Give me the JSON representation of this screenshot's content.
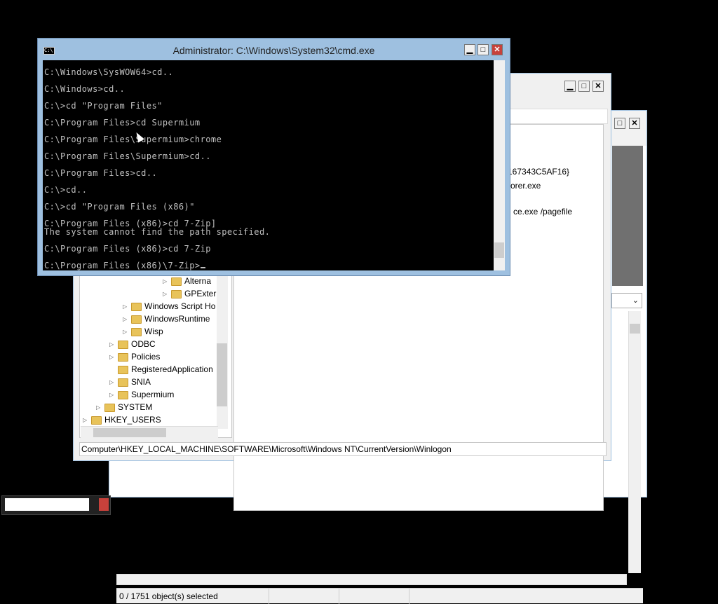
{
  "cmd_window": {
    "title": "Administrator: C:\\Windows\\System32\\cmd.exe",
    "icon": "cmd-icon",
    "buttons": {
      "minimize": "▁",
      "maximize": "□",
      "close": "✕"
    },
    "lines": [
      "C:\\Windows\\SysWOW64>cd..",
      "",
      "C:\\Windows>cd..",
      "",
      "C:\\>cd \"Program Files\"",
      "",
      "C:\\Program Files>cd Supermium",
      "",
      "C:\\Program Files\\Supermium>chrome",
      "",
      "C:\\Program Files\\Supermium>cd..",
      "",
      "C:\\Program Files>cd..",
      "",
      "C:\\>cd..",
      "",
      "C:\\>cd \"Program Files (x86)\"",
      "",
      "C:\\Program Files (x86)>cd 7-Zip]",
      "The system cannot find the path specified.",
      "",
      "C:\\Program Files (x86)>cd 7-Zip",
      "",
      "C:\\Program Files (x86)\\7-Zip>"
    ]
  },
  "registry_window": {
    "buttons": {
      "minimize": "▁",
      "maximize": "□",
      "close": "✕"
    },
    "tree": [
      {
        "label": "Alterna",
        "level": 3,
        "expandable": true
      },
      {
        "label": "GPExter",
        "level": 3,
        "expandable": true
      },
      {
        "label": "Windows Script Ho",
        "level": 2,
        "expandable": true
      },
      {
        "label": "WindowsRuntime",
        "level": 2,
        "expandable": true
      },
      {
        "label": "Wisp",
        "level": 2,
        "expandable": true
      },
      {
        "label": "ODBC",
        "level": 1,
        "expandable": true
      },
      {
        "label": "Policies",
        "level": 1,
        "expandable": true
      },
      {
        "label": "RegisteredApplication",
        "level": 1,
        "expandable": false
      },
      {
        "label": "SNIA",
        "level": 1,
        "expandable": true
      },
      {
        "label": "Supermium",
        "level": 1,
        "expandable": true
      },
      {
        "label": "SYSTEM",
        "level": 0,
        "expandable": true
      },
      {
        "label": "HKEY_USERS",
        "level": -1,
        "expandable": true
      }
    ],
    "values": [
      "-167343C5AF16}",
      "orer.exe",
      "ce.exe /pagefile"
    ],
    "address": "Computer\\HKEY_LOCAL_MACHINE\\SOFTWARE\\Microsoft\\Windows NT\\CurrentVersion\\Winlogon"
  },
  "sevenzip_window": {
    "buttons": {
      "maximize": "□",
      "close": "✕"
    },
    "status": "0 / 1751 object(s) selected",
    "combo_arrow": "⌄"
  },
  "taskbar": {
    "item": ""
  }
}
